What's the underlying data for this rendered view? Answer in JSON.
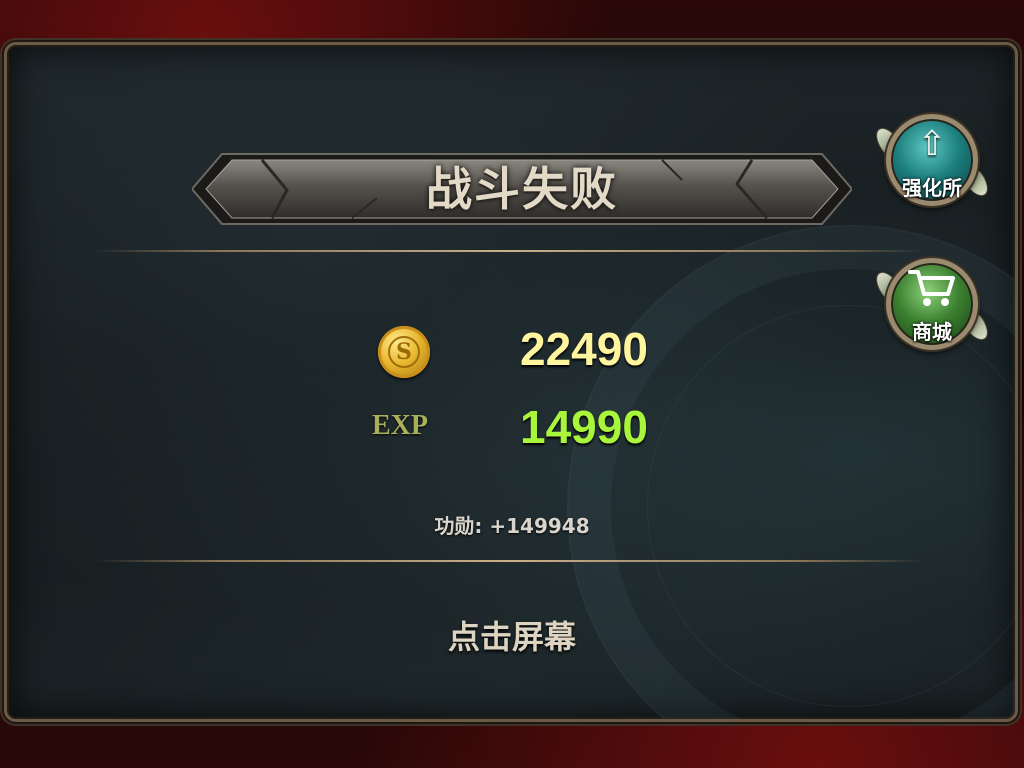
{
  "result": {
    "title": "战斗失败"
  },
  "rewards": {
    "coin_icon": "gold-coin-icon",
    "coin_symbol": "S",
    "gold_value": "22490",
    "exp_label": "EXP",
    "exp_value": "14990",
    "merit_text": "功勋: +149948"
  },
  "prompt": {
    "tap_text": "点击屏幕"
  },
  "side_buttons": {
    "forge": {
      "label": "强化所",
      "icon": "winged-up-arrow-icon",
      "glyph": "⇧"
    },
    "shop": {
      "label": "商城",
      "icon": "shopping-cart-icon",
      "glyph": "🛒"
    }
  },
  "colors": {
    "gold_value": "#fff59e",
    "exp_value": "#a8f53c",
    "exp_label": "#a8b05a",
    "title": "#e2d9c6",
    "forge_button": "#1c7f7e",
    "shop_button": "#3b8030"
  }
}
